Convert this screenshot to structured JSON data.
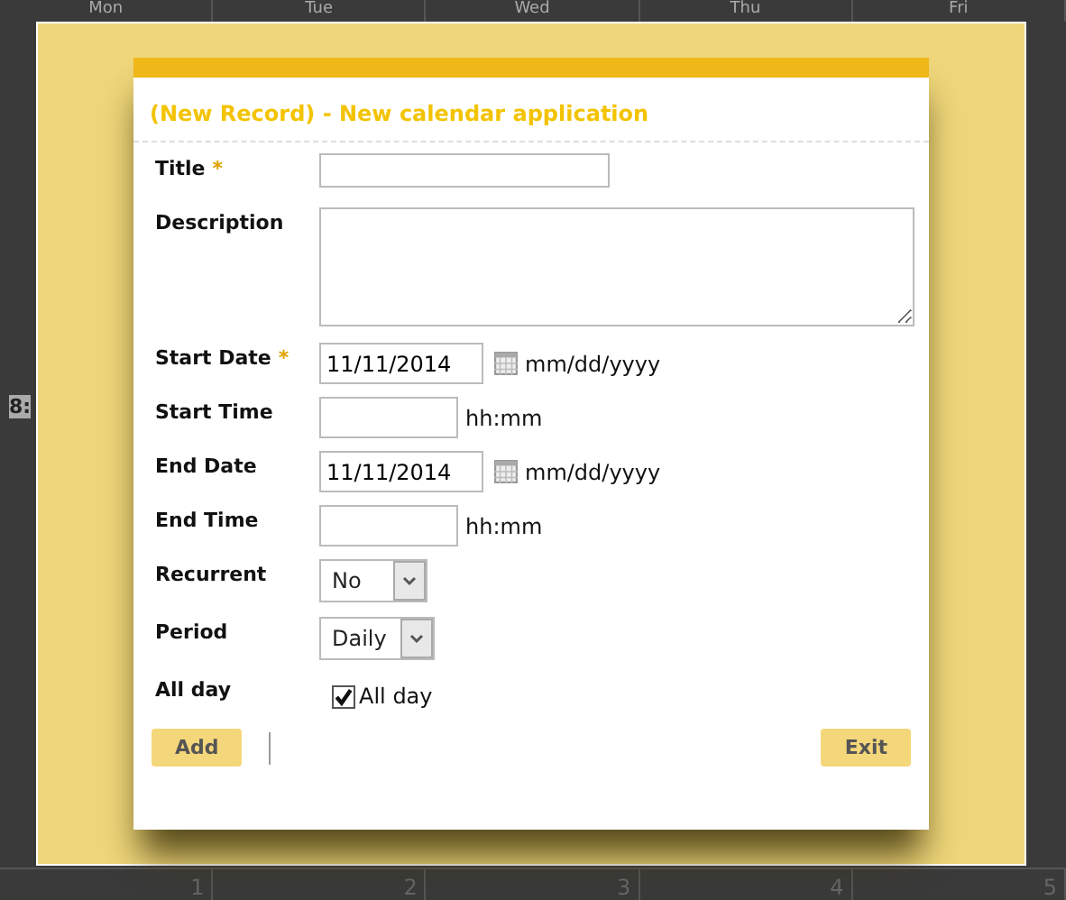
{
  "calendar": {
    "day_headers": [
      "Mon",
      "Tue",
      "Wed",
      "Thu",
      "Fri"
    ],
    "time_label": "8:",
    "day_numbers": [
      "1",
      "2",
      "3",
      "4",
      "5"
    ]
  },
  "dialog": {
    "title": "(New Record) - New calendar application",
    "fields": [
      {
        "kind": "text",
        "label": "Title",
        "required_mark": "*"
      },
      {
        "kind": "textarea",
        "label": "Description"
      },
      {
        "kind": "date",
        "label": "Start Date",
        "required_mark": "*",
        "value": "11/11/2014",
        "hint": "mm/dd/yyyy"
      },
      {
        "kind": "time",
        "label": "Start Time",
        "hint": "hh:mm"
      },
      {
        "kind": "date",
        "label": "End Date",
        "value": "11/11/2014",
        "hint": "mm/dd/yyyy"
      },
      {
        "kind": "time",
        "label": "End Time",
        "hint": "hh:mm"
      },
      {
        "kind": "select",
        "label": "Recurrent",
        "value": "No"
      },
      {
        "kind": "select",
        "label": "Period",
        "value": "Daily"
      },
      {
        "kind": "checkbox",
        "label": "All day",
        "checked": true,
        "text": "All day"
      }
    ],
    "buttons": [
      {
        "label": "Add",
        "kind": "primary"
      },
      {
        "label": "Exit",
        "kind": "secondary"
      }
    ]
  }
}
